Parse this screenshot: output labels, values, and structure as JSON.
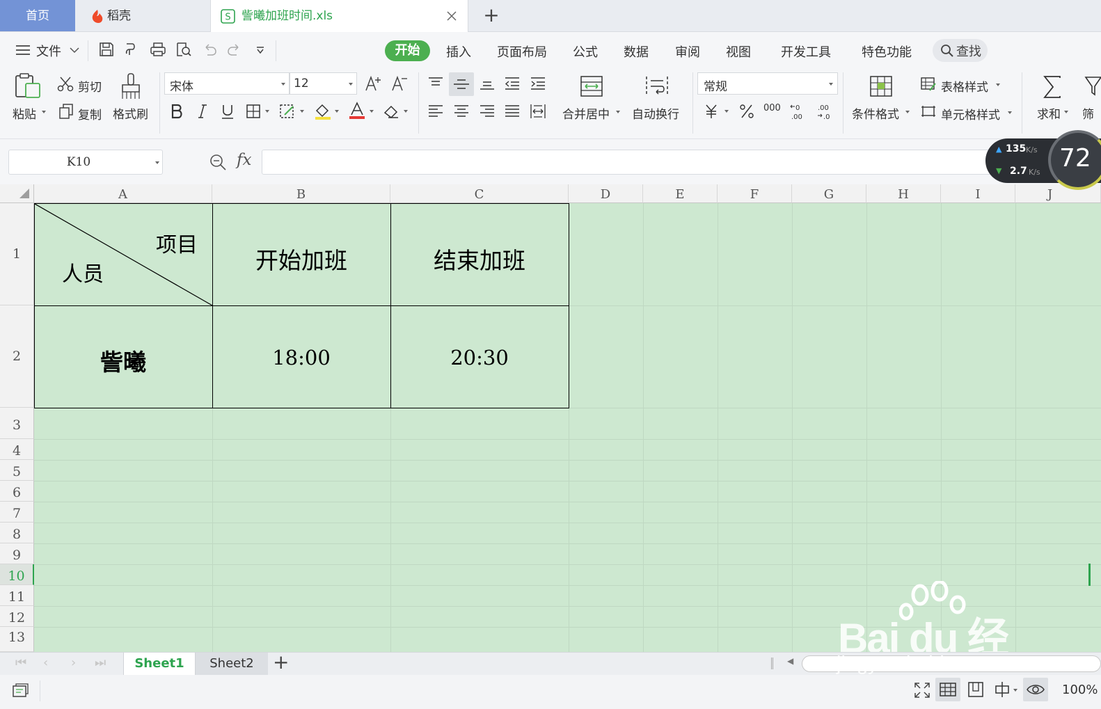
{
  "tabs": {
    "home": "首页",
    "daoke": "稻壳",
    "file": "訾曦加班时间.xls",
    "new_tab": "+"
  },
  "menu": {
    "file": "文件",
    "items": [
      "开始",
      "插入",
      "页面布局",
      "公式",
      "数据",
      "审阅",
      "视图",
      "开发工具",
      "特色功能"
    ],
    "search": "查找"
  },
  "ribbon": {
    "paste": "粘贴",
    "cut": "剪切",
    "copy": "复制",
    "format_painter": "格式刷",
    "font_name": "宋体",
    "font_size": "12",
    "merge_center": "合并居中",
    "wrap_text": "自动换行",
    "number_format": "常规",
    "cond_format": "条件格式",
    "table_style": "表格样式",
    "cell_style": "单元格样式",
    "sum": "求和",
    "filter": "筛"
  },
  "formula_bar": {
    "name_box": "K10",
    "fx": "fx",
    "value": ""
  },
  "net_widget": {
    "up": "135",
    "down": "2.7",
    "unit": "K/s",
    "percent": "72"
  },
  "sheet": {
    "columns": [
      "A",
      "B",
      "C",
      "D",
      "E",
      "F",
      "G",
      "H",
      "I",
      "J"
    ],
    "rows": [
      "1",
      "2",
      "3",
      "4",
      "5",
      "6",
      "7",
      "8",
      "9",
      "10",
      "11",
      "12",
      "13"
    ],
    "a1_top": "项目",
    "a1_bottom": "人员",
    "b1": "开始加班",
    "c1": "结束加班",
    "a2": "訾曦",
    "b2": "18:00",
    "c2": "20:30"
  },
  "sheet_tabs": {
    "tabs": [
      "Sheet1",
      "Sheet2"
    ],
    "add": "+"
  },
  "status": {
    "zoom": "100%"
  },
  "colors": {
    "accent": "#4caf50",
    "grid_bg": "#cde8d0",
    "tab_blue": "#6c8fd1"
  }
}
